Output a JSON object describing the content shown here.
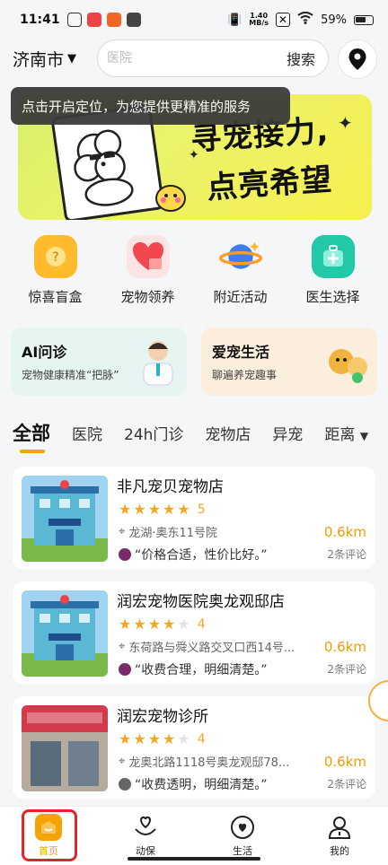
{
  "status_bar": {
    "time": "11:41",
    "net_speed_value": "1.40",
    "net_speed_unit": "MB/s",
    "battery": "59%"
  },
  "header": {
    "city": "济南市",
    "search_placeholder": "医院",
    "search_button": "搜索"
  },
  "banner": {
    "tooltip": "点击开启定位，为您提供更精准的服务",
    "title_line1": "寻宠接力,",
    "title_line2": "点亮希望"
  },
  "quick_nav": [
    {
      "label": "惊喜盲盒",
      "icon": "blind-box-icon",
      "color": "#ffb627"
    },
    {
      "label": "宠物领养",
      "icon": "heart-box-icon",
      "color": "#f0484e"
    },
    {
      "label": "附近活动",
      "icon": "planet-icon",
      "color": "#3f7cf0"
    },
    {
      "label": "医生选择",
      "icon": "medical-kit-icon",
      "color": "#22c9a7"
    }
  ],
  "feature_cards": [
    {
      "title": "AI问诊",
      "subtitle": "宠物健康精准“把脉”",
      "bg": "#e6f5f2"
    },
    {
      "title": "爱宠生活",
      "subtitle": "聊遍养宠趣事",
      "bg": "#fbeedd"
    }
  ],
  "tabs": [
    "全部",
    "医院",
    "24h门诊",
    "宠物店",
    "异宠",
    "距离"
  ],
  "shops": [
    {
      "name": "非凡宠贝宠物店",
      "rating": 5,
      "score": "5",
      "address": "龙湖·奥东11号院",
      "distance": "0.6km",
      "review": "“价格合适，性价比好。”",
      "review_count": "2条评论"
    },
    {
      "name": "润宏宠物医院奥龙观邸店",
      "rating": 4,
      "score": "4",
      "address": "东荷路与舜义路交叉口西14号...",
      "distance": "0.6km",
      "review": "“收费合理，明细清楚。”",
      "review_count": "2条评论"
    },
    {
      "name": "润宏宠物诊所",
      "rating": 4,
      "score": "4",
      "address": "龙奥北路1118号奥龙观邸78...",
      "distance": "0.6km",
      "review": "“收费透明，明细清楚。”",
      "review_count": "2条评论"
    }
  ],
  "bottom_nav": [
    {
      "label": "首页",
      "active": true
    },
    {
      "label": "动保",
      "active": false
    },
    {
      "label": "生活",
      "active": false
    },
    {
      "label": "我的",
      "active": false
    }
  ],
  "colors": {
    "accent": "#f5a300",
    "star": "#f5a623",
    "highlight_box": "#e0262a"
  }
}
